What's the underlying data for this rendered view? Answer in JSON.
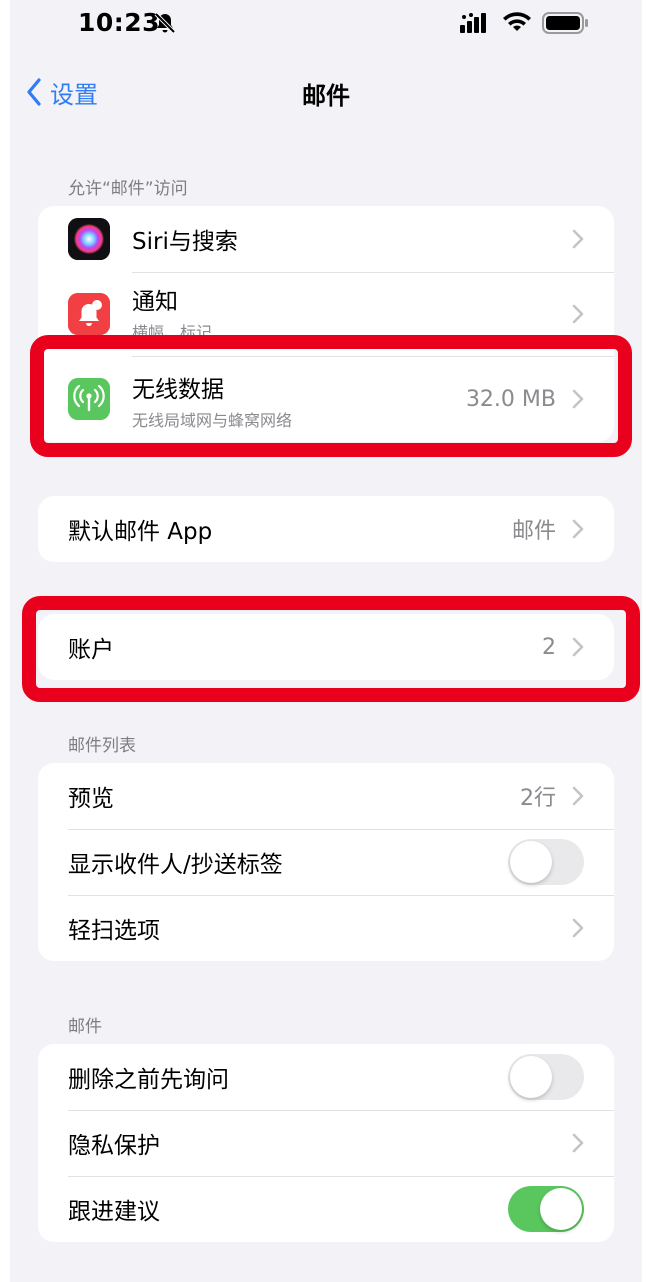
{
  "status_bar": {
    "time": "10:23"
  },
  "nav": {
    "back_label": "设置",
    "title": "邮件"
  },
  "allow_section": {
    "header": "允许“邮件”访问",
    "items": [
      {
        "label": "Siri与搜索",
        "icon": "siri-icon"
      },
      {
        "label": "通知",
        "sublabel": "横幅、标记",
        "icon": "notification-icon",
        "icon_color": "#f23f44"
      },
      {
        "label": "无线数据",
        "sublabel": "无线局域网与蜂窝网络",
        "value": "32.0 MB",
        "icon": "antenna-icon",
        "icon_color": "#5ac75e"
      }
    ]
  },
  "default_app": {
    "label": "默认邮件 App",
    "value": "邮件"
  },
  "accounts": {
    "label": "账户",
    "value": "2"
  },
  "message_list": {
    "header": "邮件列表",
    "preview": {
      "label": "预览",
      "value": "2行"
    },
    "show_to_cc": {
      "label": "显示收件人/抄送标签",
      "on": false
    },
    "swipe_options": {
      "label": "轻扫选项"
    }
  },
  "messages": {
    "header": "邮件",
    "ask_before_delete": {
      "label": "删除之前先询问",
      "on": false
    },
    "privacy_protection": {
      "label": "隐私保护"
    },
    "follow_up": {
      "label": "跟进建议",
      "on": true
    }
  },
  "colors": {
    "accent": "#2f7cf6",
    "highlight": "#e8001d",
    "toggle_on": "#5ac75e"
  }
}
